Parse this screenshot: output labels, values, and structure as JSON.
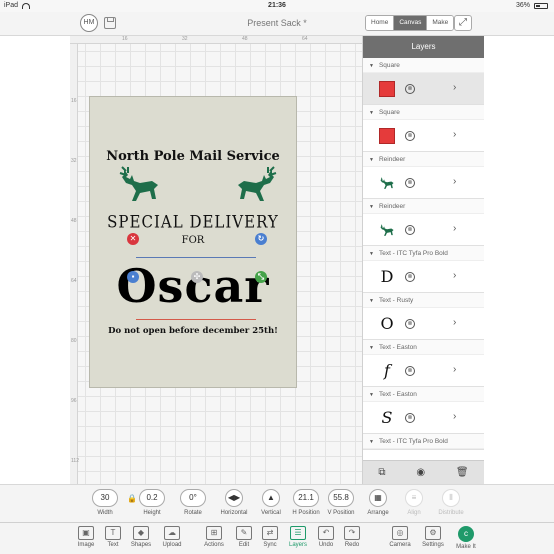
{
  "status": {
    "device": "iPad",
    "time": "21:36",
    "battery": "36%"
  },
  "topbar": {
    "avatar": "HM",
    "title": "Present Sack *",
    "tabs": [
      {
        "label": "Home",
        "active": false
      },
      {
        "label": "Canvas",
        "active": true
      },
      {
        "label": "Make",
        "active": false
      }
    ]
  },
  "rulers": {
    "top": [
      "16",
      "32",
      "48",
      "64"
    ],
    "left": [
      "16",
      "32",
      "48",
      "64",
      "80",
      "96",
      "112"
    ]
  },
  "card": {
    "title": "North Pole Mail Service",
    "special": "SPECIAL DELIVERY",
    "for": "FOR",
    "name": "Oscar",
    "footer": "Do not open before december 25th!",
    "colors": {
      "background": "#dcdcd0",
      "deer": "#1e6e4a"
    }
  },
  "layers": {
    "header": "Layers",
    "items": [
      {
        "name": "Square",
        "thumb": "square-red",
        "selected": true
      },
      {
        "name": "Square",
        "thumb": "square-red",
        "selected": false
      },
      {
        "name": "Reindeer",
        "thumb": "reindeer",
        "selected": false
      },
      {
        "name": "Reindeer",
        "thumb": "reindeer",
        "selected": false
      },
      {
        "name": "Text - ITC Tyfa Pro Bold",
        "thumb": "D",
        "selected": false
      },
      {
        "name": "Text - Rusty",
        "thumb": "O",
        "selected": false
      },
      {
        "name": "Text - Easton",
        "thumb": "f",
        "selected": false
      },
      {
        "name": "Text - Easton",
        "thumb": "S",
        "selected": false
      },
      {
        "name": "Text - ITC Tyfa Pro Bold",
        "thumb": "",
        "selected": false
      }
    ],
    "footer_icons": [
      "group-icon",
      "visibility-icon",
      "delete-icon"
    ]
  },
  "sizebar": {
    "width": {
      "value": "30",
      "label": "Width"
    },
    "height": {
      "value": "0.2",
      "label": "Height"
    },
    "rotate": {
      "value": "0°",
      "label": "Rotate"
    },
    "horizontal": {
      "label": "Horizontal"
    },
    "vertical": {
      "label": "Vertical"
    },
    "hpos": {
      "value": "21.1",
      "label": "H Position"
    },
    "vpos": {
      "value": "55.8",
      "label": "V Position"
    },
    "arrange": {
      "label": "Arrange"
    },
    "align": {
      "label": "Align"
    },
    "distribute": {
      "label": "Distribute"
    }
  },
  "toolbar": {
    "items": [
      {
        "label": "Image",
        "icon": "image-icon",
        "active": false
      },
      {
        "label": "Text",
        "icon": "text-icon",
        "active": false
      },
      {
        "label": "Shapes",
        "icon": "shapes-icon",
        "active": false
      },
      {
        "label": "Upload",
        "icon": "upload-icon",
        "active": false
      },
      {
        "label": "Actions",
        "icon": "actions-icon",
        "active": false
      },
      {
        "label": "Edit",
        "icon": "edit-icon",
        "active": false
      },
      {
        "label": "Sync",
        "icon": "sync-icon",
        "active": false
      },
      {
        "label": "Layers",
        "icon": "layers-icon",
        "active": true
      },
      {
        "label": "Undo",
        "icon": "undo-icon",
        "active": false
      },
      {
        "label": "Redo",
        "icon": "redo-icon",
        "active": false
      },
      {
        "label": "Camera",
        "icon": "camera-icon",
        "active": false
      },
      {
        "label": "Settings",
        "icon": "settings-icon",
        "active": false
      },
      {
        "label": "Make It",
        "icon": "make-it-icon",
        "active": false
      }
    ]
  }
}
